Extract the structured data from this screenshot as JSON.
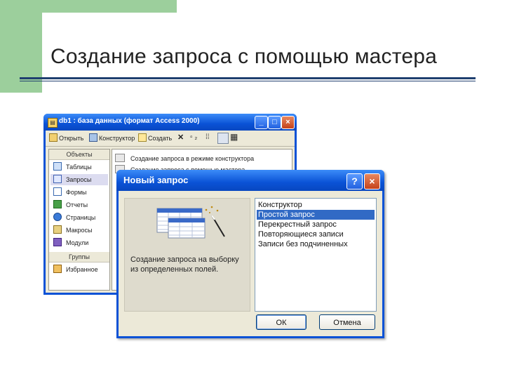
{
  "slide": {
    "title": "Создание запроса с помощью мастера"
  },
  "db_window": {
    "title": "db1 : база данных (формат Access 2000)",
    "controls": {
      "minimize": "_",
      "maximize": "□",
      "close": "×"
    },
    "toolbar": {
      "open": "Открыть",
      "design": "Конструктор",
      "create": "Создать"
    },
    "sidebar": {
      "objects_header": "Объекты",
      "items": [
        {
          "label": "Таблицы",
          "icon": "table-icon"
        },
        {
          "label": "Запросы",
          "icon": "query-icon",
          "selected": true
        },
        {
          "label": "Формы",
          "icon": "form-icon"
        },
        {
          "label": "Отчеты",
          "icon": "report-icon"
        },
        {
          "label": "Страницы",
          "icon": "page-icon"
        },
        {
          "label": "Макросы",
          "icon": "macro-icon"
        },
        {
          "label": "Модули",
          "icon": "module-icon"
        }
      ],
      "groups_header": "Группы",
      "groups": [
        {
          "label": "Избранное",
          "icon": "favorites-icon"
        }
      ]
    },
    "objects": [
      "Создание запроса в режиме конструктора",
      "Создание запроса с помощью мастера"
    ]
  },
  "dialog": {
    "title": "Новый запрос",
    "help": "?",
    "close": "×",
    "description": "Создание запроса на выборку из определенных полей.",
    "types": [
      {
        "label": "Конструктор"
      },
      {
        "label": "Простой запрос",
        "selected": true
      },
      {
        "label": "Перекрестный запрос"
      },
      {
        "label": "Повторяющиеся записи"
      },
      {
        "label": "Записи без подчиненных"
      }
    ],
    "ok": "ОК",
    "cancel": "Отмена"
  },
  "colors": {
    "titlebar_blue": "#0a52d6",
    "selection_blue": "#316ac5",
    "slide_green": "#9ccf9c",
    "title_rule": "#1f3f6f"
  }
}
